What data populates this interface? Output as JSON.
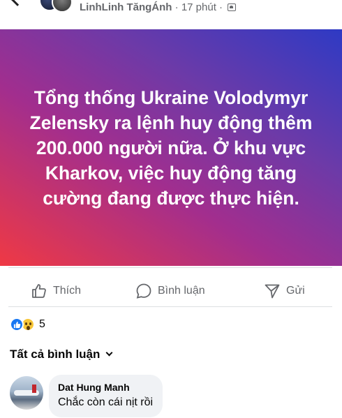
{
  "header": {
    "author_name": "LinhLinh TăngÁnh",
    "separator": "·",
    "time": "17 phút",
    "privacy_icon": "friends-icon"
  },
  "post": {
    "text": "Tổng thống Ukraine Volodymyr Zelensky ra lệnh huy động thêm 200.000 người nữa. Ở khu vực Kharkov, việc huy động tăng cường đang được thực hiện.",
    "gradient_colors": [
      "#ef3944",
      "#a22e8e",
      "#6c3aa8",
      "#2e3ac4"
    ]
  },
  "actions": {
    "like_label": "Thích",
    "comment_label": "Bình luận",
    "share_label": "Gửi"
  },
  "reactions": {
    "types": [
      "like",
      "wow"
    ],
    "count": "5"
  },
  "comments_filter": {
    "label": "Tất cả bình luận"
  },
  "comments": [
    {
      "author": "Dat Hung Manh",
      "text": "Chắc còn cái nịt rồi"
    }
  ],
  "colors": {
    "secondary_text": "#65676b",
    "like_blue": "#1877f2",
    "bubble_bg": "#f0f2f5"
  }
}
